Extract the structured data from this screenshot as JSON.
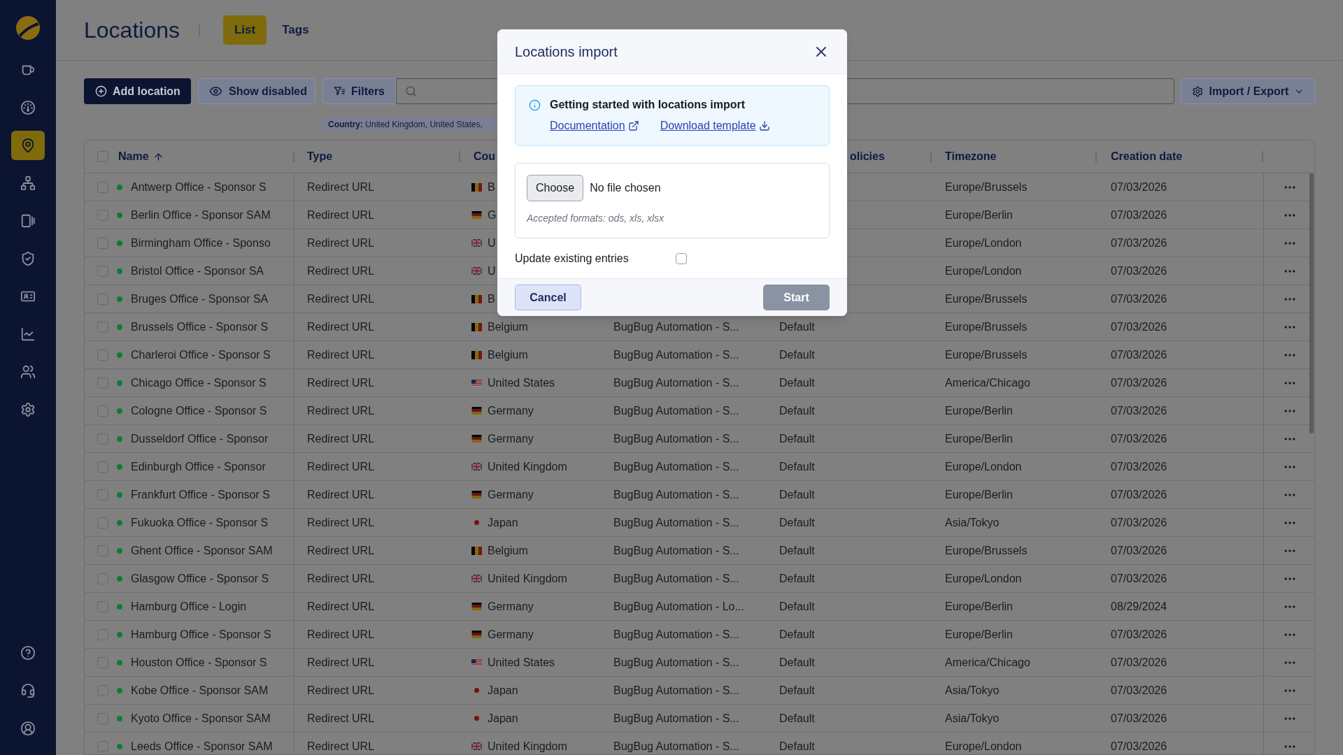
{
  "sidebar": {
    "items": [
      {
        "selected": false
      },
      {
        "selected": false
      },
      {
        "selected": true
      },
      {
        "selected": false
      },
      {
        "selected": false
      },
      {
        "selected": false
      },
      {
        "selected": false
      },
      {
        "selected": false
      },
      {
        "selected": false
      },
      {
        "selected": false
      }
    ]
  },
  "header": {
    "title": "Locations",
    "tabs": [
      {
        "label": "List",
        "selected": true
      },
      {
        "label": "Tags",
        "selected": false
      }
    ]
  },
  "toolbar": {
    "buttons": [
      {
        "label": "Add location",
        "kind": "add"
      },
      {
        "label": "Show disabled",
        "kind": "visibility"
      },
      {
        "label": "Filters",
        "kind": "filter"
      }
    ],
    "menu_button": {
      "label": "Import / Export"
    }
  },
  "filter_chips": [
    {
      "text": "**Country:** United Kingdom, United States,"
    }
  ],
  "table": {
    "header_checkbox": {
      "checked": false
    },
    "columns": {
      "name": {
        "label": "Name",
        "sorted": true
      },
      "type": {
        "label": "Type"
      },
      "column_3": {
        "label": "Cou"
      },
      "column_5": {
        "label": "olicies"
      },
      "timezone": {
        "label": "Timezone"
      },
      "creation_date": {
        "label": "Creation date"
      }
    },
    "rows": [
      {
        "checked": false,
        "enabled": true,
        "name": "Antwerp Office - Sponsor S",
        "type": "Redirect URL",
        "column_3": {
          "kind": "belgium",
          "text": "B"
        },
        "timezone": "Europe/Brussels",
        "creation_date": "07/03/2026"
      },
      {
        "checked": false,
        "enabled": true,
        "name": "Berlin Office - Sponsor SAM",
        "type": "Redirect URL",
        "column_3": {
          "kind": "germany",
          "text": "G"
        },
        "timezone": "Europe/Berlin",
        "creation_date": "07/03/2026"
      },
      {
        "checked": false,
        "enabled": true,
        "name": "Birmingham Office - Sponso",
        "type": "Redirect URL",
        "column_3": {
          "kind": "britain",
          "text": "U"
        },
        "timezone": "Europe/London",
        "creation_date": "07/03/2026"
      },
      {
        "checked": false,
        "enabled": true,
        "name": "Bristol Office - Sponsor SA",
        "type": "Redirect URL",
        "column_3": {
          "kind": "britain",
          "text": "U"
        },
        "timezone": "Europe/London",
        "creation_date": "07/03/2026"
      },
      {
        "checked": false,
        "enabled": true,
        "name": "Bruges Office - Sponsor SA",
        "type": "Redirect URL",
        "column_3": {
          "kind": "belgium",
          "text": "B"
        },
        "timezone": "Europe/Brussels",
        "creation_date": "07/03/2026"
      },
      {
        "checked": false,
        "enabled": true,
        "name": "Brussels Office - Sponsor S",
        "type": "Redirect URL",
        "column_3": {
          "kind": "belgium",
          "text": "Belgium"
        },
        "column_4": "BugBug Automation - S...",
        "column_5": "Default",
        "timezone": "Europe/Brussels",
        "creation_date": "07/03/2026"
      },
      {
        "checked": false,
        "enabled": true,
        "name": "Charleroi Office - Sponsor S",
        "type": "Redirect URL",
        "column_3": {
          "kind": "belgium",
          "text": "Belgium"
        },
        "column_4": "BugBug Automation - S...",
        "column_5": "Default",
        "timezone": "Europe/Brussels",
        "creation_date": "07/03/2026"
      },
      {
        "checked": false,
        "enabled": true,
        "name": "Chicago Office - Sponsor S",
        "type": "Redirect URL",
        "column_3": {
          "kind": "usa",
          "text": "United States"
        },
        "column_4": "BugBug Automation - S...",
        "column_5": "Default",
        "timezone": "America/Chicago",
        "creation_date": "07/03/2026"
      },
      {
        "checked": false,
        "enabled": true,
        "name": "Cologne Office - Sponsor S",
        "type": "Redirect URL",
        "column_3": {
          "kind": "germany",
          "text": "Germany"
        },
        "column_4": "BugBug Automation - S...",
        "column_5": "Default",
        "timezone": "Europe/Berlin",
        "creation_date": "07/03/2026"
      },
      {
        "checked": false,
        "enabled": true,
        "name": "Dusseldorf Office - Sponsor",
        "type": "Redirect URL",
        "column_3": {
          "kind": "germany",
          "text": "Germany"
        },
        "column_4": "BugBug Automation - S...",
        "column_5": "Default",
        "timezone": "Europe/Berlin",
        "creation_date": "07/03/2026"
      },
      {
        "checked": false,
        "enabled": true,
        "name": "Edinburgh Office - Sponsor",
        "type": "Redirect URL",
        "column_3": {
          "kind": "britain",
          "text": "United Kingdom"
        },
        "column_4": "BugBug Automation - S...",
        "column_5": "Default",
        "timezone": "Europe/London",
        "creation_date": "07/03/2026"
      },
      {
        "checked": false,
        "enabled": true,
        "name": "Frankfurt Office - Sponsor S",
        "type": "Redirect URL",
        "column_3": {
          "kind": "germany",
          "text": "Germany"
        },
        "column_4": "BugBug Automation - S...",
        "column_5": "Default",
        "timezone": "Europe/Berlin",
        "creation_date": "07/03/2026"
      },
      {
        "checked": false,
        "enabled": true,
        "name": "Fukuoka Office - Sponsor S",
        "type": "Redirect URL",
        "column_3": {
          "kind": "japan",
          "text": "Japan"
        },
        "column_4": "BugBug Automation - S...",
        "column_5": "Default",
        "timezone": "Asia/Tokyo",
        "creation_date": "07/03/2026"
      },
      {
        "checked": false,
        "enabled": true,
        "name": "Ghent Office - Sponsor SAM",
        "type": "Redirect URL",
        "column_3": {
          "kind": "belgium",
          "text": "Belgium"
        },
        "column_4": "BugBug Automation - S...",
        "column_5": "Default",
        "timezone": "Europe/Brussels",
        "creation_date": "07/03/2026"
      },
      {
        "checked": false,
        "enabled": true,
        "name": "Glasgow Office - Sponsor S",
        "type": "Redirect URL",
        "column_3": {
          "kind": "britain",
          "text": "United Kingdom"
        },
        "column_4": "BugBug Automation - S...",
        "column_5": "Default",
        "timezone": "Europe/London",
        "creation_date": "07/03/2026"
      },
      {
        "checked": false,
        "enabled": true,
        "name": "Hamburg Office - Login",
        "type": "Redirect URL",
        "column_3": {
          "kind": "germany",
          "text": "Germany"
        },
        "column_4": "BugBug Automation - Lo...",
        "column_5": "Default",
        "timezone": "Europe/Berlin",
        "creation_date": "08/29/2024"
      },
      {
        "checked": false,
        "enabled": true,
        "name": "Hamburg Office - Sponsor S",
        "type": "Redirect URL",
        "column_3": {
          "kind": "germany",
          "text": "Germany"
        },
        "column_4": "BugBug Automation - S...",
        "column_5": "Default",
        "timezone": "Europe/Berlin",
        "creation_date": "07/03/2026"
      },
      {
        "checked": false,
        "enabled": true,
        "name": "Houston Office - Sponsor S",
        "type": "Redirect URL",
        "column_3": {
          "kind": "usa",
          "text": "United States"
        },
        "column_4": "BugBug Automation - S...",
        "column_5": "Default",
        "timezone": "America/Chicago",
        "creation_date": "07/03/2026"
      },
      {
        "checked": false,
        "enabled": true,
        "name": "Kobe Office - Sponsor SAM",
        "type": "Redirect URL",
        "column_3": {
          "kind": "japan",
          "text": "Japan"
        },
        "column_4": "BugBug Automation - S...",
        "column_5": "Default",
        "timezone": "Asia/Tokyo",
        "creation_date": "07/03/2026"
      },
      {
        "checked": false,
        "enabled": true,
        "name": "Kyoto Office - Sponsor SAM",
        "type": "Redirect URL",
        "column_3": {
          "kind": "japan",
          "text": "Japan"
        },
        "column_4": "BugBug Automation - S...",
        "column_5": "Default",
        "timezone": "Asia/Tokyo",
        "creation_date": "07/03/2026"
      },
      {
        "checked": false,
        "enabled": true,
        "name": "Leeds Office - Sponsor SAM",
        "type": "Redirect URL",
        "column_3": {
          "kind": "britain",
          "text": "United Kingdom"
        },
        "column_4": "BugBug Automation - S...",
        "column_5": "Default",
        "timezone": "Europe/London",
        "creation_date": "07/03/2026"
      }
    ]
  },
  "dialog": {
    "title": "Locations import",
    "info": {
      "title": "Getting started with locations import",
      "links": [
        {
          "label": "Documentation",
          "kind": "external"
        },
        {
          "label": "Download template",
          "kind": "download"
        }
      ]
    },
    "file_input": {
      "button": "Choose",
      "status": "No file chosen",
      "hint": "Accepted formats: ods, xls, xlsx"
    },
    "update_existing": {
      "label": "Update existing entries",
      "checked": false
    },
    "buttons": [
      {
        "label": "Cancel",
        "kind": "cancel",
        "disabled": false
      },
      {
        "label": "Start",
        "kind": "start",
        "disabled": true
      }
    ]
  }
}
